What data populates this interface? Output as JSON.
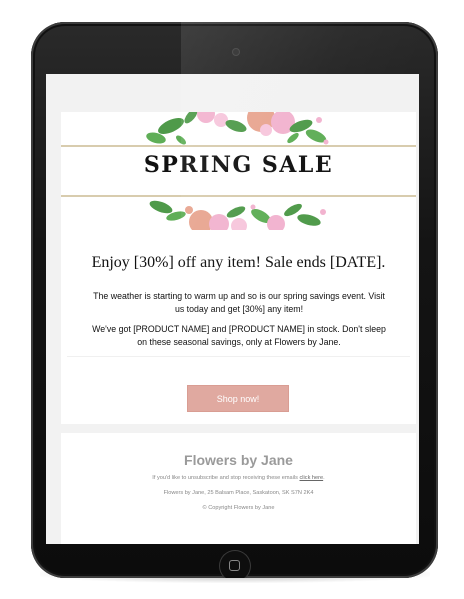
{
  "hero": {
    "title": "SPRING SALE"
  },
  "email": {
    "headline": "Enjoy [30%] off any item! Sale ends [DATE].",
    "paragraph1": "The weather is starting to warm up and so is our spring savings event. Visit us today and get [30%] any item!",
    "paragraph2": "We've got [PRODUCT NAME] and [PRODUCT NAME] in stock. Don't sleep on these seasonal savings, only at Flowers by Jane.",
    "cta_label": "Shop now!",
    "cta_color": "#e0a9a0"
  },
  "footer": {
    "brand": "Flowers by Jane",
    "unsubscribe_text": "If you'd like to unsubscribe and stop receiving these emails ",
    "unsubscribe_link": "click here",
    "unsubscribe_end": ".",
    "address": "Flowers by Jane, 25 Balsam Place, Saskatoon, SK S7N 2K4",
    "copyright": "© Copyright Flowers by Jane"
  },
  "colors": {
    "band_line": "#d8ccae",
    "leaf": "#4f9a4a",
    "petal_pink": "#f2b3cf",
    "petal_peach": "#e8a590"
  }
}
